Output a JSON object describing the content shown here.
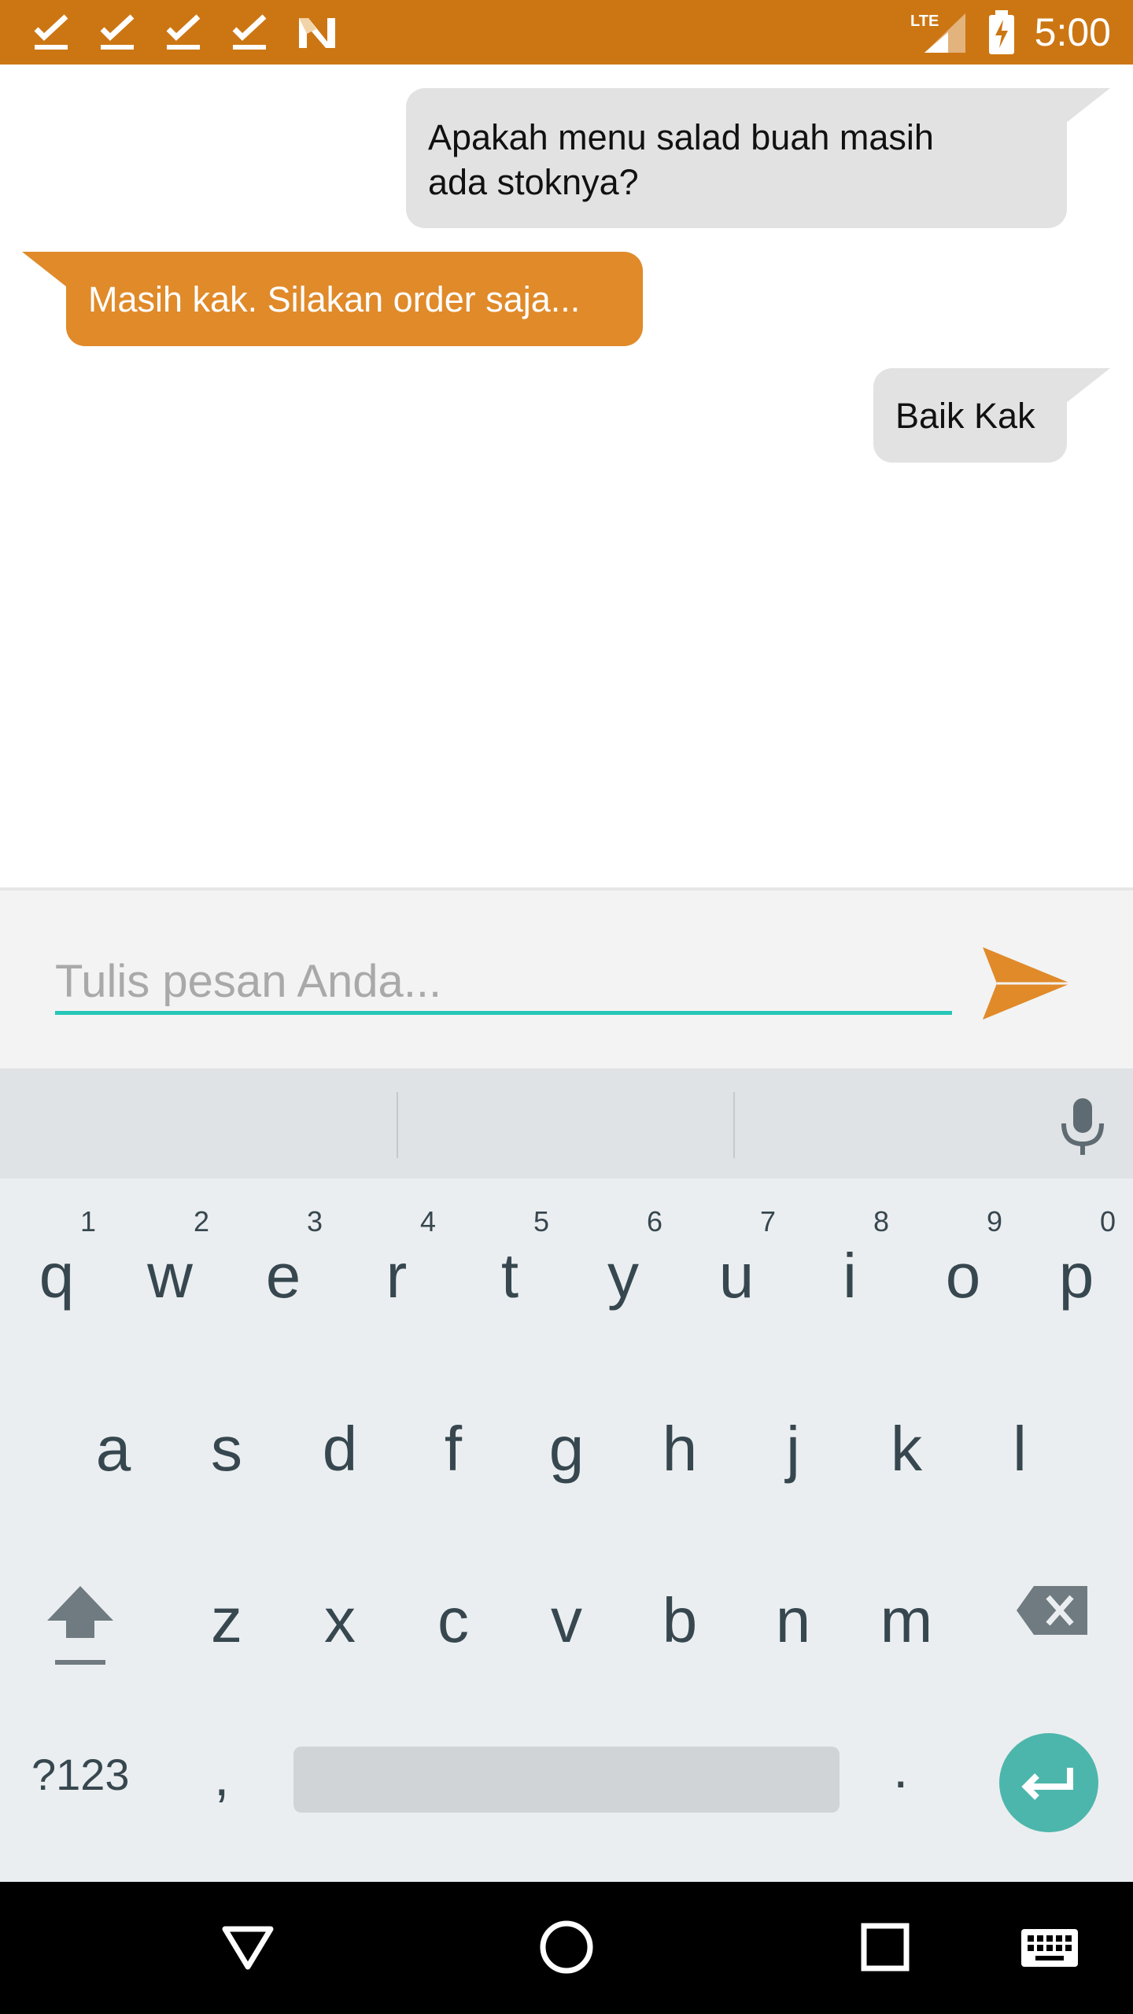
{
  "status_bar": {
    "time": "5:00",
    "network": "LTE",
    "bg_color": "#cc7613",
    "left_icons": [
      "check-icon",
      "check-icon",
      "check-icon",
      "check-icon",
      "n-logo-icon"
    ]
  },
  "chat": {
    "messages": [
      {
        "side": "sent",
        "text_line1": "Apakah menu salad buah masih",
        "text_line2": "ada stoknya?"
      },
      {
        "side": "recv",
        "text": "Masih kak. Silakan order saja..."
      },
      {
        "side": "sent",
        "text": "Baik Kak"
      }
    ],
    "sent_color": "#e2e2e2",
    "recv_color": "#e08a2a"
  },
  "composer": {
    "placeholder": "Tulis pesan Anda...",
    "value": "",
    "accent_color": "#26c6b7",
    "send_color": "#e08a2a"
  },
  "keyboard": {
    "row1": [
      {
        "k": "q",
        "h": "1"
      },
      {
        "k": "w",
        "h": "2"
      },
      {
        "k": "e",
        "h": "3"
      },
      {
        "k": "r",
        "h": "4"
      },
      {
        "k": "t",
        "h": "5"
      },
      {
        "k": "y",
        "h": "6"
      },
      {
        "k": "u",
        "h": "7"
      },
      {
        "k": "i",
        "h": "8"
      },
      {
        "k": "o",
        "h": "9"
      },
      {
        "k": "p",
        "h": "0"
      }
    ],
    "row2": [
      "a",
      "s",
      "d",
      "f",
      "g",
      "h",
      "j",
      "k",
      "l"
    ],
    "row3": [
      "z",
      "x",
      "c",
      "v",
      "b",
      "n",
      "m"
    ],
    "symbols_label": "?123",
    "comma_label": ",",
    "period_label": "."
  },
  "nav": {
    "icons": [
      "back-icon",
      "home-icon",
      "recents-icon",
      "keyboard-icon"
    ]
  }
}
